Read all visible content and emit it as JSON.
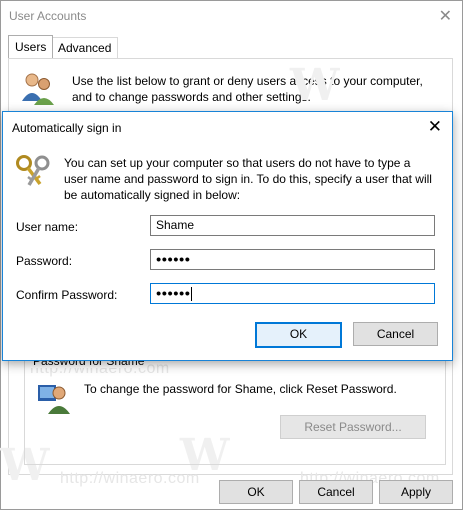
{
  "window": {
    "title": "User Accounts",
    "close_glyph": "✕"
  },
  "tabs": [
    {
      "label": "Users",
      "active": true
    },
    {
      "label": "Advanced",
      "active": false
    }
  ],
  "intro": {
    "icon": "users-icon",
    "text": "Use the list below to grant or deny users access to your computer, and to change passwords and other settings."
  },
  "password_group": {
    "title": "Password for Shame",
    "icon": "user-password-icon",
    "text": "To change the password for Shame, click Reset Password.",
    "reset_label": "Reset Password..."
  },
  "bottom_buttons": {
    "ok": "OK",
    "cancel": "Cancel",
    "apply": "Apply"
  },
  "watermark": {
    "logo": "W",
    "text": "http://winaero.com"
  },
  "dialog": {
    "title": "Automatically sign in",
    "close_glyph": "✕",
    "icon": "keys-icon",
    "description": "You can set up your computer so that users do not have to type a user name and password to sign in. To do this, specify a user that will be automatically signed in below:",
    "fields": {
      "username_label": "User name:",
      "username_value": "Shame",
      "password_label": "Password:",
      "password_value": "••••••",
      "confirm_label": "Confirm Password:",
      "confirm_value": "••••••"
    },
    "ok_label": "OK",
    "cancel_label": "Cancel"
  },
  "colors": {
    "accent": "#0078d7",
    "dialog_border": "#1883d7"
  }
}
